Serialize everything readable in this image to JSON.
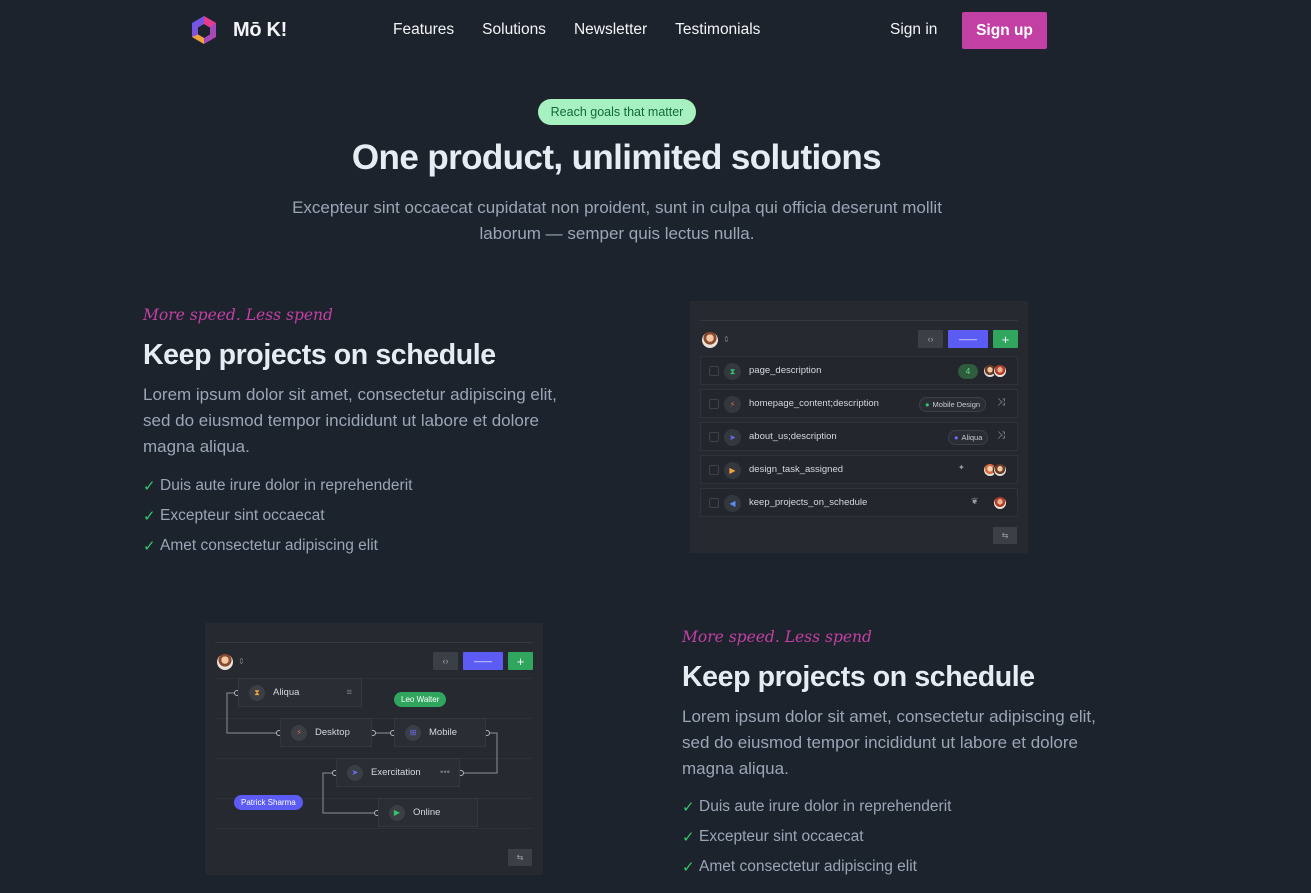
{
  "brand": {
    "name": "Mō K!"
  },
  "nav": {
    "links": [
      "Features",
      "Solutions",
      "Newsletter",
      "Testimonials"
    ],
    "signin": "Sign in",
    "signup": "Sign up"
  },
  "hero": {
    "pill": "Reach goals that matter",
    "title": "One product, unlimited solutions",
    "subtitle": "Excepteur sint occaecat cupidatat non proident, sunt in culpa qui officia deserunt mollit laborum — semper quis lectus nulla."
  },
  "features": [
    {
      "eyebrow": "More speed. Less spend",
      "title": "Keep projects on schedule",
      "description": "Lorem ipsum dolor sit amet, consectetur adipiscing elit, sed do eiusmod tempor incididunt ut labore et dolore magna aliqua.",
      "bullets": [
        "Duis aute irure dolor in reprehenderit",
        "Excepteur sint occaecat",
        "Amet consectetur adipiscing elit"
      ]
    },
    {
      "eyebrow": "More speed. Less spend",
      "title": "Keep projects on schedule",
      "description": "Lorem ipsum dolor sit amet, consectetur adipiscing elit, sed do eiusmod tempor incididunt ut labore et dolore magna aliqua.",
      "bullets": [
        "Duis aute irure dolor in reprehenderit",
        "Excepteur sint occaecat",
        "Amet consectetur adipiscing elit"
      ]
    }
  ],
  "task_mock": {
    "rows": [
      {
        "label": "page_description",
        "count": "4"
      },
      {
        "label": "homepage_content;description",
        "tag": "Mobile Design"
      },
      {
        "label": "about_us;description",
        "tag": "Aliqua"
      },
      {
        "label": "design_task_assigned"
      },
      {
        "label": "keep_projects_on_schedule"
      }
    ]
  },
  "flow_mock": {
    "nodes": [
      "Aliqua",
      "Desktop",
      "Mobile",
      "Exercitation",
      "Online"
    ],
    "chips": [
      "Leo Walter",
      "Patrick Sharma"
    ]
  },
  "colors": {
    "background": "#1d232d",
    "accent": "#c240a3",
    "pill_bg": "#a7f0c0",
    "check": "#34c56a",
    "blue": "#5c5cf5",
    "green": "#2fa55e"
  }
}
